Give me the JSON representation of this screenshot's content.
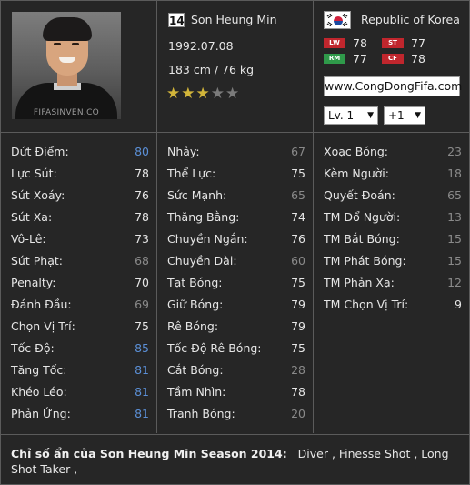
{
  "player": {
    "photo_watermark": "FIFASINVEN.CO",
    "number": "14",
    "name": "Son Heung Min",
    "dob": "1992.07.08",
    "height_weight": "183 cm / 76 kg",
    "stars": 3,
    "stars_max": 5,
    "country": "Republic of Korea",
    "flag_icon": "south-korea-flag-icon"
  },
  "positions": [
    {
      "code": "LW",
      "value": "78",
      "color": "#c0262d"
    },
    {
      "code": "ST",
      "value": "77",
      "color": "#c0262d"
    },
    {
      "code": "RM",
      "value": "77",
      "color": "#2f9a4a"
    },
    {
      "code": "CF",
      "value": "78",
      "color": "#c0262d"
    }
  ],
  "site_link": "www.CongDongFifa.com",
  "level_select": "Lv. 1",
  "plus_select": "+1",
  "colors": {
    "high": "#e6e6e6",
    "mid_blue": "#5b8fd6",
    "low": "#8a8a8a"
  },
  "stats": {
    "col1": [
      {
        "label": "Dứt Điểm:",
        "value": "80",
        "tier": "blue"
      },
      {
        "label": "Lực Sút:",
        "value": "78",
        "tier": "high"
      },
      {
        "label": "Sút Xoáy:",
        "value": "76",
        "tier": "high"
      },
      {
        "label": "Sút Xa:",
        "value": "78",
        "tier": "high"
      },
      {
        "label": "Vô-Lê:",
        "value": "73",
        "tier": "high"
      },
      {
        "label": "Sút Phạt:",
        "value": "68",
        "tier": "low"
      },
      {
        "label": "Penalty:",
        "value": "70",
        "tier": "high"
      },
      {
        "label": "Đánh Đầu:",
        "value": "69",
        "tier": "low"
      },
      {
        "label": "Chọn Vị Trí:",
        "value": "75",
        "tier": "high"
      },
      {
        "label": "Tốc Độ:",
        "value": "85",
        "tier": "blue"
      },
      {
        "label": "Tăng Tốc:",
        "value": "81",
        "tier": "blue"
      },
      {
        "label": "Khéo Léo:",
        "value": "81",
        "tier": "blue"
      },
      {
        "label": "Phản Ứng:",
        "value": "81",
        "tier": "blue"
      }
    ],
    "col2": [
      {
        "label": "Nhảy:",
        "value": "67",
        "tier": "low"
      },
      {
        "label": "Thể Lực:",
        "value": "75",
        "tier": "high"
      },
      {
        "label": "Sức Mạnh:",
        "value": "65",
        "tier": "low"
      },
      {
        "label": "Thăng Bằng:",
        "value": "74",
        "tier": "high"
      },
      {
        "label": "Chuyền Ngắn:",
        "value": "76",
        "tier": "high"
      },
      {
        "label": "Chuyền Dài:",
        "value": "60",
        "tier": "low"
      },
      {
        "label": "Tạt Bóng:",
        "value": "75",
        "tier": "high"
      },
      {
        "label": "Giữ Bóng:",
        "value": "79",
        "tier": "high"
      },
      {
        "label": "Rê Bóng:",
        "value": "79",
        "tier": "high"
      },
      {
        "label": "Tốc Độ Rê Bóng:",
        "value": "75",
        "tier": "high"
      },
      {
        "label": "Cắt Bóng:",
        "value": "28",
        "tier": "low"
      },
      {
        "label": "Tầm Nhìn:",
        "value": "78",
        "tier": "high"
      },
      {
        "label": "Tranh Bóng:",
        "value": "20",
        "tier": "low"
      }
    ],
    "col3": [
      {
        "label": "Xoạc Bóng:",
        "value": "23",
        "tier": "low"
      },
      {
        "label": "Kèm Người:",
        "value": "18",
        "tier": "low"
      },
      {
        "label": "Quyết Đoán:",
        "value": "65",
        "tier": "low"
      },
      {
        "label": "TM Đổ Người:",
        "value": "13",
        "tier": "low"
      },
      {
        "label": "TM Bắt Bóng:",
        "value": "15",
        "tier": "low"
      },
      {
        "label": "TM Phát Bóng:",
        "value": "15",
        "tier": "low"
      },
      {
        "label": "TM Phản Xạ:",
        "value": "12",
        "tier": "low"
      },
      {
        "label": "TM Chọn Vị Trí:",
        "value": "9",
        "tier": "high"
      }
    ]
  },
  "hidden_traits": {
    "heading": "Chỉ số ẩn của Son Heung Min Season 2014:",
    "traits": "Diver , Finesse Shot , Long Shot Taker ,"
  }
}
